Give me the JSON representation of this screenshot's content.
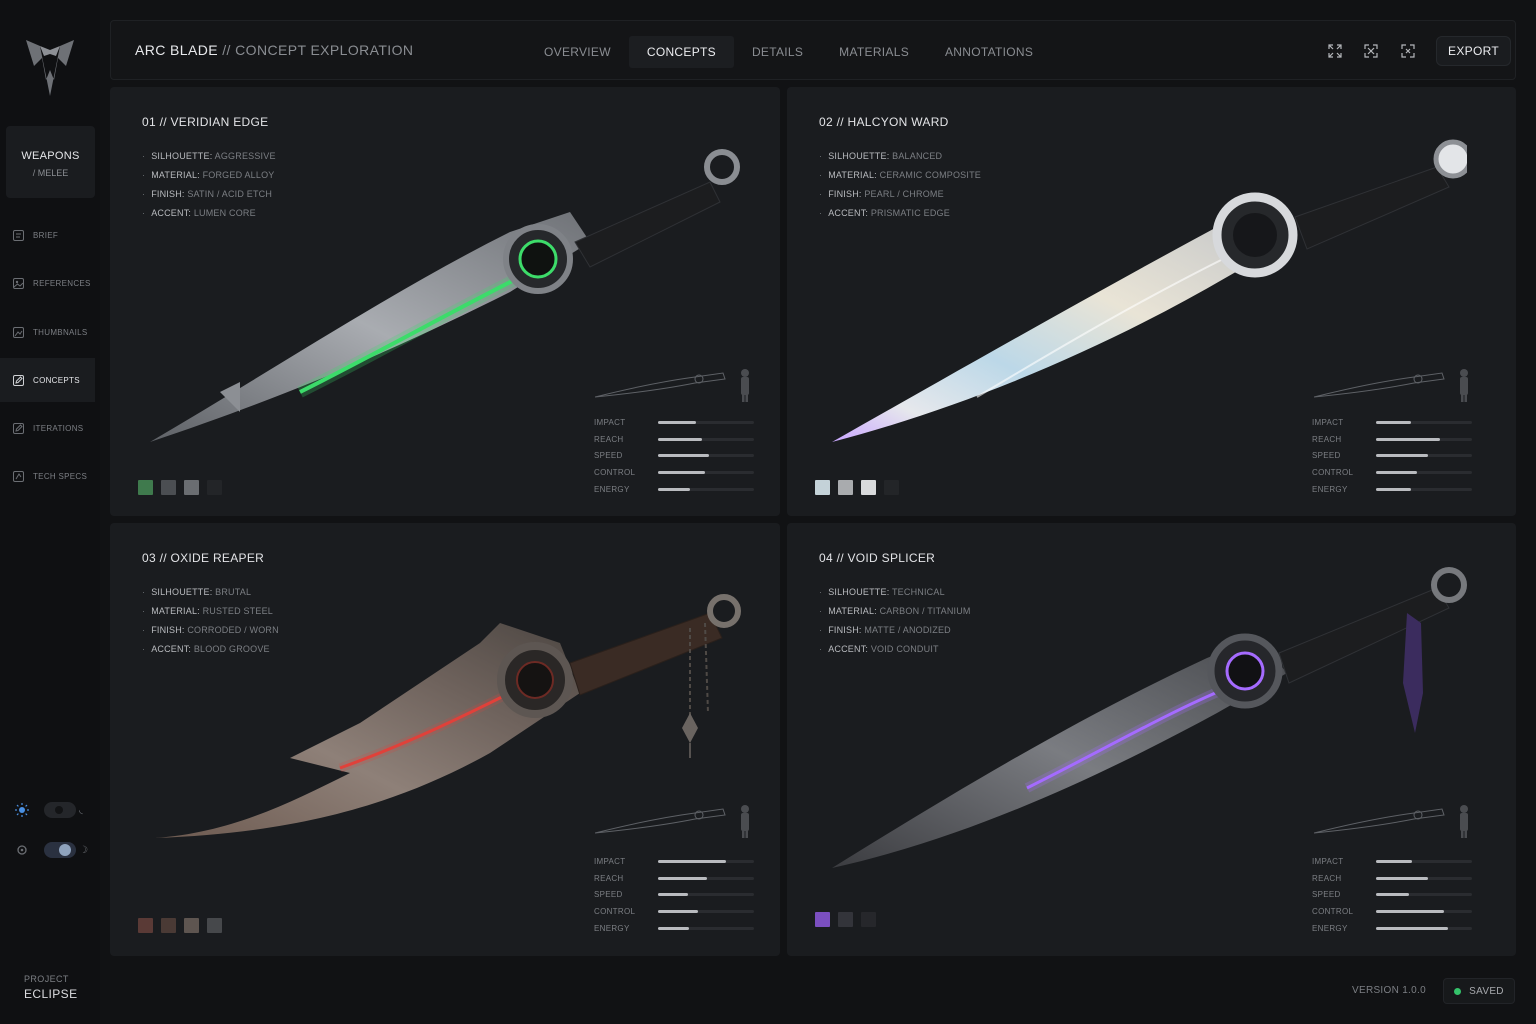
{
  "sidebar": {
    "category": {
      "title": "WEAPONS",
      "subtitle": "/ MELEE"
    },
    "items": [
      {
        "label": "BRIEF",
        "icon": "document-icon",
        "active": false
      },
      {
        "label": "REFERENCES",
        "icon": "image-icon",
        "active": false
      },
      {
        "label": "THUMBNAILS",
        "icon": "thumbnails-icon",
        "active": false
      },
      {
        "label": "CONCEPTS",
        "icon": "pencil-icon",
        "active": true
      },
      {
        "label": "ITERATIONS",
        "icon": "iterations-icon",
        "active": false
      },
      {
        "label": "TECH SPECS",
        "icon": "tech-specs-icon",
        "active": false
      }
    ],
    "toggles": [
      {
        "icon": "sun-icon",
        "state": "off"
      },
      {
        "icon": "settings-icon",
        "end_icon": "moon-icon",
        "state": "on"
      }
    ],
    "project": {
      "label": "PROJECT",
      "name": "ECLIPSE"
    }
  },
  "header": {
    "title_main": "ARC BLADE",
    "title_sep": "//",
    "title_sub": "CONCEPT EXPLORATION",
    "tabs": [
      {
        "label": "OVERVIEW",
        "active": false
      },
      {
        "label": "CONCEPTS",
        "active": true
      },
      {
        "label": "DETAILS",
        "active": false
      },
      {
        "label": "MATERIALS",
        "active": false
      },
      {
        "label": "ANNOTATIONS",
        "active": false
      }
    ],
    "icons": [
      "expand-icon",
      "fit-view-icon",
      "focus-icon"
    ],
    "export_label": "EXPORT"
  },
  "concepts": [
    {
      "title": "01 // VERIDIAN EDGE",
      "specs": [
        {
          "key": "SILHOUETTE:",
          "value": "AGGRESSIVE"
        },
        {
          "key": "MATERIAL:",
          "value": "FORGED ALLOY"
        },
        {
          "key": "FINISH:",
          "value": "SATIN / ACID ETCH"
        },
        {
          "key": "ACCENT:",
          "value": "LUMEN CORE"
        }
      ],
      "stats": [
        {
          "label": "IMPACT",
          "value": 0.4
        },
        {
          "label": "REACH",
          "value": 0.46
        },
        {
          "label": "SPEED",
          "value": 0.53
        },
        {
          "label": "CONTROL",
          "value": 0.49
        },
        {
          "label": "ENERGY",
          "value": 0.33
        }
      ],
      "swatches": [
        "#3f7a4d",
        "#4b4e52",
        "#6a6d71",
        "#232528"
      ],
      "accent": "#3ddc6a"
    },
    {
      "title": "02 // HALCYON WARD",
      "specs": [
        {
          "key": "SILHOUETTE:",
          "value": "BALANCED"
        },
        {
          "key": "MATERIAL:",
          "value": "CERAMIC COMPOSITE"
        },
        {
          "key": "FINISH:",
          "value": "PEARL / CHROME"
        },
        {
          "key": "ACCENT:",
          "value": "PRISMATIC EDGE"
        }
      ],
      "stats": [
        {
          "label": "IMPACT",
          "value": 0.36
        },
        {
          "label": "REACH",
          "value": 0.67
        },
        {
          "label": "SPEED",
          "value": 0.54
        },
        {
          "label": "CONTROL",
          "value": 0.43
        },
        {
          "label": "ENERGY",
          "value": 0.36
        }
      ],
      "swatches": [
        "#c4d2d8",
        "#a9abae",
        "#d9dadc",
        "#232528"
      ],
      "accent": "#c8d6ff"
    },
    {
      "title": "03 // OXIDE REAPER",
      "specs": [
        {
          "key": "SILHOUETTE:",
          "value": "BRUTAL"
        },
        {
          "key": "MATERIAL:",
          "value": "RUSTED STEEL"
        },
        {
          "key": "FINISH:",
          "value": "CORRODED / WORN"
        },
        {
          "key": "ACCENT:",
          "value": "BLOOD GROOVE"
        }
      ],
      "stats": [
        {
          "label": "IMPACT",
          "value": 0.71
        },
        {
          "label": "REACH",
          "value": 0.51
        },
        {
          "label": "SPEED",
          "value": 0.31
        },
        {
          "label": "CONTROL",
          "value": 0.42
        },
        {
          "label": "ENERGY",
          "value": 0.32
        }
      ],
      "swatches": [
        "#5a3a36",
        "#4a3a35",
        "#5e5550",
        "#46484b"
      ],
      "accent": "#e0413a"
    },
    {
      "title": "04 // VOID SPLICER",
      "specs": [
        {
          "key": "SILHOUETTE:",
          "value": "TECHNICAL"
        },
        {
          "key": "MATERIAL:",
          "value": "CARBON / TITANIUM"
        },
        {
          "key": "FINISH:",
          "value": "MATTE / ANODIZED"
        },
        {
          "key": "ACCENT:",
          "value": "VOID CONDUIT"
        }
      ],
      "stats": [
        {
          "label": "IMPACT",
          "value": 0.37
        },
        {
          "label": "REACH",
          "value": 0.54
        },
        {
          "label": "SPEED",
          "value": 0.34
        },
        {
          "label": "CONTROL",
          "value": 0.71
        },
        {
          "label": "ENERGY",
          "value": 0.75
        }
      ],
      "swatches": [
        "#7b4fc0",
        "#33343a",
        "#26272b"
      ],
      "accent": "#a56bff"
    }
  ],
  "footer": {
    "version": "VERSION 1.0.0",
    "status": "SAVED",
    "status_color": "#34c26a"
  }
}
